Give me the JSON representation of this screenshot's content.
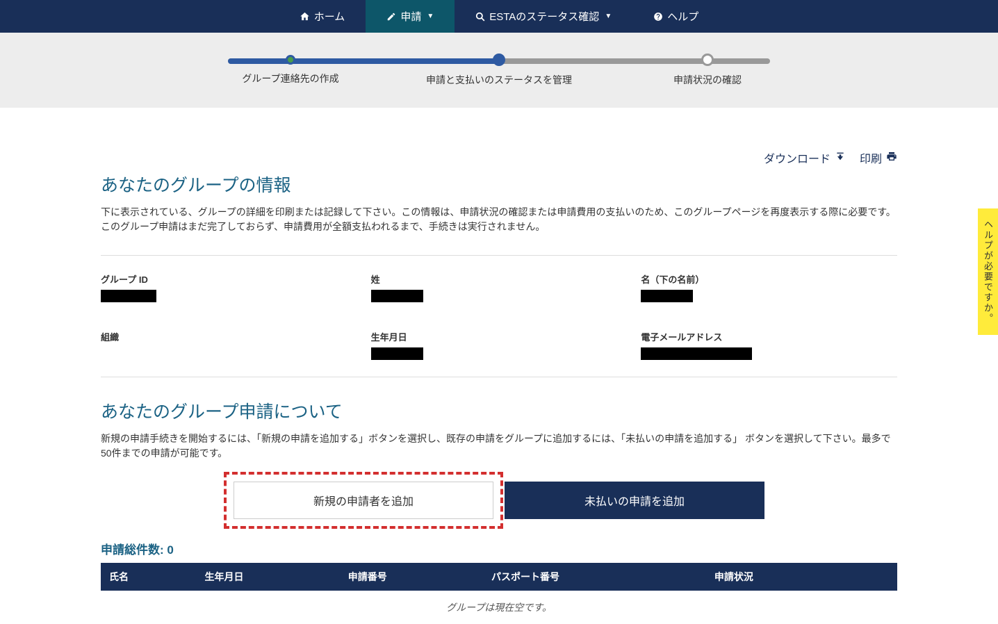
{
  "nav": {
    "home": "ホーム",
    "apply": "申請",
    "status": "ESTAのステータス確認",
    "help": "ヘルプ"
  },
  "progress": {
    "step1": "グループ連絡先の作成",
    "step2": "申請と支払いのステータスを管理",
    "step3": "申請状況の確認"
  },
  "actions": {
    "download": "ダウンロード",
    "print": "印刷"
  },
  "groupInfo": {
    "title": "あなたのグループの情報",
    "desc": "下に表示されている、グループの詳細を印刷または記録して下さい。この情報は、申請状況の確認または申請費用の支払いのため、このグループページを再度表示する際に必要です。このグループ申請はまだ完了しておらず、申請費用が全額支払われるまで、手続きは実行されません。",
    "labels": {
      "groupId": "グループ ID",
      "lastName": "姓",
      "firstName": "名（下の名前）",
      "org": "組織",
      "dob": "生年月日",
      "email": "電子メールアドレス"
    }
  },
  "groupApp": {
    "title": "あなたのグループ申請について",
    "desc": "新規の申請手続きを開始するには、「新規の申請を追加する」ボタンを選択し、既存の申請をグループに追加するには、「未払いの申請を追加する」 ボタンを選択して下さい。最多で50件までの申請が可能です。",
    "addNew": "新規の申請者を追加",
    "addUnpaid": "未払いの申請を追加"
  },
  "table": {
    "totalLabel": "申請総件数: ",
    "totalCount": "0",
    "headers": {
      "name": "氏名",
      "dob": "生年月日",
      "appNum": "申請番号",
      "passport": "パスポート番号",
      "status": "申請状況"
    },
    "empty": "グループは現在空です。"
  },
  "helpTab": "ヘルプが必要ですか。"
}
